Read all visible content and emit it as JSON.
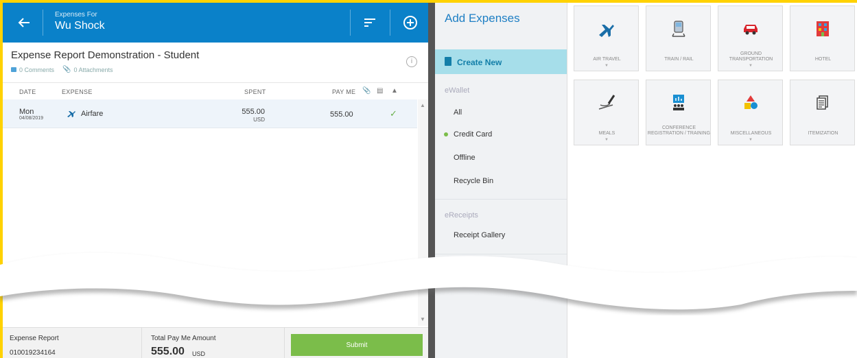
{
  "header": {
    "subtitle": "Expenses For",
    "user_name": "Wu Shock"
  },
  "report": {
    "title": "Expense Report Demonstration - Student",
    "comments": "0 Comments",
    "attachments": "0 Attachments"
  },
  "columns": {
    "date": "DATE",
    "expense": "EXPENSE",
    "spent": "SPENT",
    "pay_me": "PAY ME"
  },
  "rows": [
    {
      "day": "Mon",
      "date": "04/08/2019",
      "expense": "Airfare",
      "spent": "555.00",
      "currency": "USD",
      "pay_me": "555.00"
    }
  ],
  "footer": {
    "report_label": "Expense Report",
    "report_id": "010019234164",
    "total_label": "Total Pay Me Amount",
    "total_amount": "555.00",
    "total_currency": "USD",
    "submit_label": "Submit"
  },
  "sidebar": {
    "title": "Add Expenses",
    "create_new": "Create New",
    "ewallet_label": "eWallet",
    "ewallet_items": [
      "All",
      "Credit Card",
      "Offline",
      "Recycle Bin"
    ],
    "ereceipts_label": "eReceipts",
    "ereceipts_items": [
      "Receipt Gallery"
    ]
  },
  "tiles": [
    {
      "label": "AIR TRAVEL",
      "icon": "airplane-icon"
    },
    {
      "label": "TRAIN / RAIL",
      "icon": "train-icon"
    },
    {
      "label": "GROUND TRANSPORTATION",
      "icon": "car-icon"
    },
    {
      "label": "HOTEL",
      "icon": "hotel-icon"
    },
    {
      "label": "MEALS",
      "icon": "meals-icon"
    },
    {
      "label": "CONFERENCE REGISTRATION / TRAINING",
      "icon": "conference-icon"
    },
    {
      "label": "MISCELLANEOUS",
      "icon": "shapes-icon"
    },
    {
      "label": "ITEMIZATION",
      "icon": "itemization-icon"
    }
  ],
  "colors": {
    "header_blue": "#0a81c9",
    "accent_blue": "#1e7fc4",
    "create_bg": "#a6deea",
    "submit_green": "#7bbd4a",
    "frame_yellow": "#ffd200"
  }
}
